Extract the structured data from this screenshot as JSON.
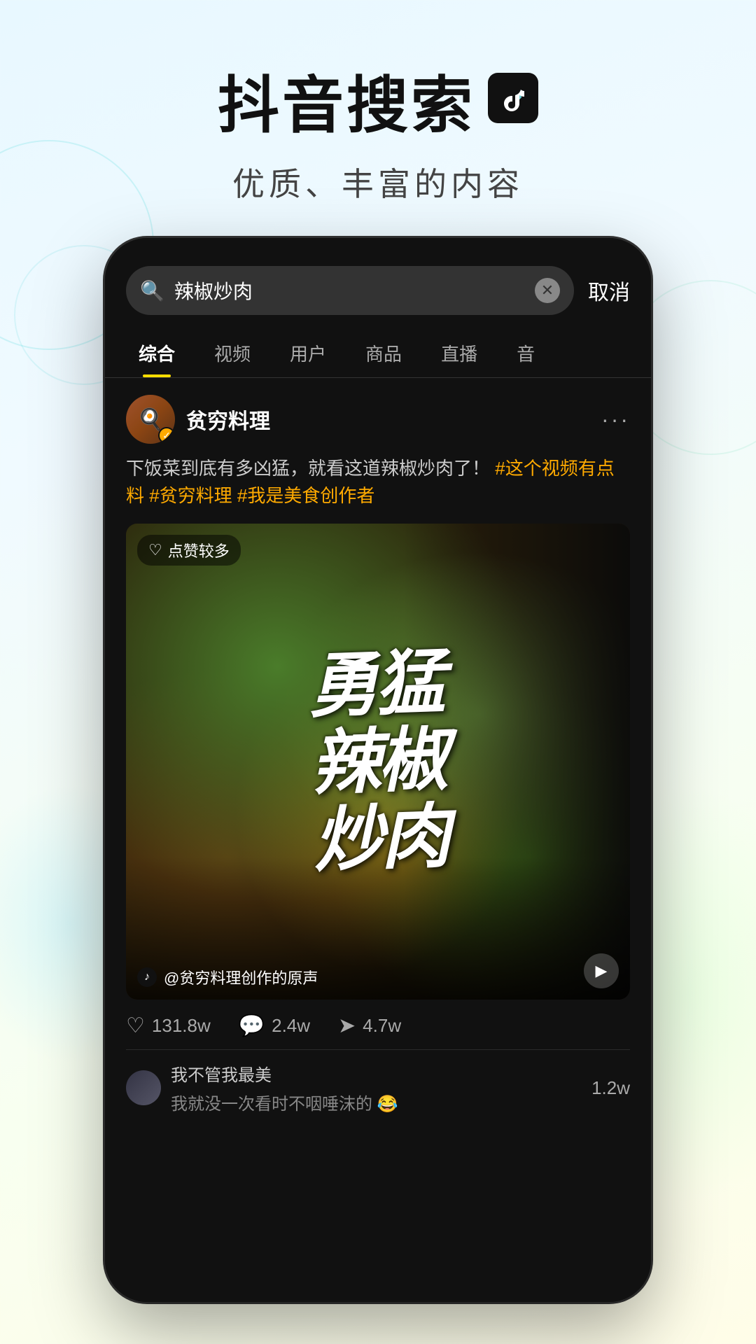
{
  "app": {
    "title": "抖音搜索",
    "tiktok_logo": "♪",
    "subtitle": "优质、丰富的内容"
  },
  "search": {
    "query": "辣椒炒肉",
    "cancel_label": "取消",
    "placeholder": "辣椒炒肉"
  },
  "tabs": [
    {
      "label": "综合",
      "active": true
    },
    {
      "label": "视频",
      "active": false
    },
    {
      "label": "用户",
      "active": false
    },
    {
      "label": "商品",
      "active": false
    },
    {
      "label": "直播",
      "active": false
    },
    {
      "label": "音",
      "active": false
    }
  ],
  "result": {
    "username": "贫穷料理",
    "verified": true,
    "description": "下饭菜到底有多凶猛，就看这道辣椒炒肉了！",
    "tags": "#这个视频有点料 #贫穷料理 #我是美食创作者",
    "like_badge": "点赞较多",
    "video_text": "勇猛辣椒炒肉",
    "audio_text": "@贫穷料理创作的原声",
    "likes": "131.8w",
    "comments": "2.4w",
    "shares": "4.7w",
    "comment1_author": "我不管我最美",
    "comment1_text": "我就没一次看时不咽唾沫的 😂",
    "comment1_count": "1.2w",
    "more_icon": "···"
  },
  "icons": {
    "search": "🔍",
    "clear": "✕",
    "tiktok": "♪",
    "heart": "♡",
    "chat": "💬",
    "share": "➤",
    "play": "▶",
    "verified": "✓"
  }
}
